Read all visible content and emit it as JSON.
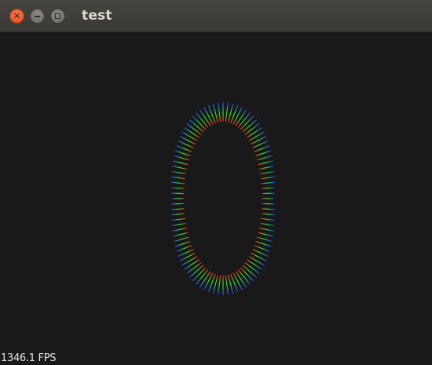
{
  "window": {
    "title": "test",
    "close_icon": "close-icon",
    "minimize_icon": "minimize-icon",
    "maximize_icon": "maximize-icon"
  },
  "overlay": {
    "fps_text": "1346.1 FPS"
  },
  "colors": {
    "background": "#191919",
    "titlebar": "#3c3b37",
    "close_button": "#df4b1a",
    "normal_base": "#ff2a1a",
    "normal_mid": "#2aff2a",
    "normal_tip": "#2a3aff"
  }
}
